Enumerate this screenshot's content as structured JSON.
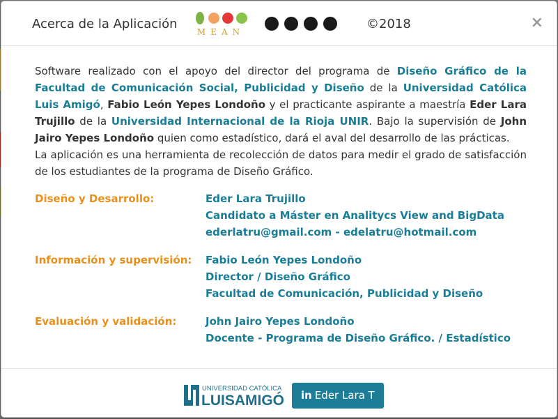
{
  "header": {
    "title": "Acerca de la Aplicación",
    "mean_logo_text": "MEAN",
    "copyright": "©2018",
    "close_symbol": "×",
    "browser_icons": [
      "chrome-icon",
      "firefox-icon",
      "edge-icon",
      "safari-icon"
    ]
  },
  "intro": {
    "p1": [
      {
        "text": "Software realizado con el apoyo del director del programa de ",
        "style": "plain"
      },
      {
        "text": "Diseño Gráfico de la Facultad de Comunicación Social, Publicidad y Diseño",
        "style": "link"
      },
      {
        "text": " de la ",
        "style": "plain"
      },
      {
        "text": "Universidad Católica Luis Amigó",
        "style": "link"
      },
      {
        "text": ", ",
        "style": "plain"
      },
      {
        "text": "Fabio León Yepes Londoño",
        "style": "bold"
      },
      {
        "text": " y el practicante aspirante a maestría ",
        "style": "plain"
      },
      {
        "text": "Eder Lara Trujillo",
        "style": "bold"
      },
      {
        "text": " de la ",
        "style": "plain"
      },
      {
        "text": "Universidad Internacional de la Rioja UNIR",
        "style": "link"
      },
      {
        "text": ". Bajo la supervisión de ",
        "style": "plain"
      },
      {
        "text": "John Jairo Yepes Londoño",
        "style": "bold"
      },
      {
        "text": " quien como estadístico, dará el aval del desarrollo de las prácticas.",
        "style": "plain"
      }
    ],
    "p2": "La aplicación es una herramienta de recolección de datos para medir el grado de satisfacción de los estudiantes de la programa de Diseño Gráfico."
  },
  "credits": [
    {
      "label": "Diseño y Desarrollo:",
      "lines": [
        "Eder Lara Trujillo",
        "Candidato a Máster en Analitycs View and BigData",
        "ederlatru@gmail.com - edelatru@hotmail.com"
      ]
    },
    {
      "label": "Información y supervisión:",
      "lines": [
        "Fabio León Yepes Londoño",
        "Director / Diseño Gráfico",
        "Facultad de Comunicación, Publicidad y Diseño"
      ]
    },
    {
      "label": "Evaluación y validación:",
      "lines": [
        "John Jairo Yepes Londoño",
        "Docente - Programa de Diseño Gráfico. / Estadístico"
      ]
    }
  ],
  "footer": {
    "logo_top": "UNIVERSIDAD CATÓLICA",
    "logo_bottom": "LUISAMIGÓ",
    "linkedin_in": "in",
    "linkedin_label": "Eder Lara T"
  },
  "colors": {
    "link": "#1a7d96",
    "label": "#e8901c",
    "button": "#1e7d96"
  }
}
